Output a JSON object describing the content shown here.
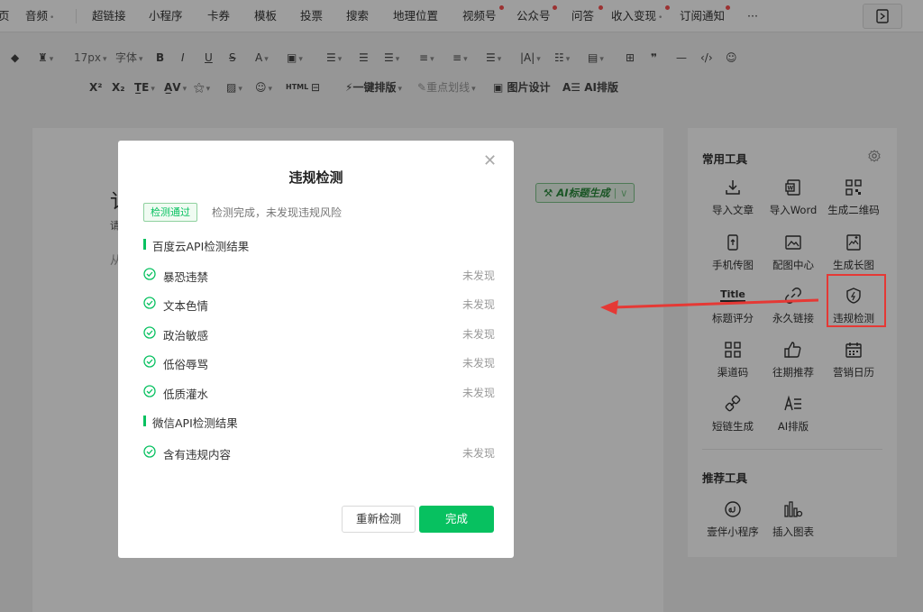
{
  "nav": {
    "items": [
      "页",
      "音频",
      "超链接",
      "小程序",
      "卡券",
      "模板",
      "投票",
      "搜索",
      "地理位置",
      "视频号",
      "公众号",
      "问答",
      "收入变现",
      "订阅通知",
      "···"
    ]
  },
  "toolbar": {
    "font_size": "17px",
    "font_family": "字体",
    "onekey_layout": "一键排版",
    "highlight": "重点划线",
    "image_design": "图片设计",
    "ai_layout": "AI排版"
  },
  "editor": {
    "title_fragment": "讠",
    "sub_fragment": "请",
    "body_fragment": "从",
    "ai_title_button": "AI标题生成"
  },
  "sidebar": {
    "common_tools_title": "常用工具",
    "tools": [
      {
        "label": "导入文章",
        "icon": "import-icon"
      },
      {
        "label": "导入Word",
        "icon": "word-icon"
      },
      {
        "label": "生成二维码",
        "icon": "qrcode-icon"
      },
      {
        "label": "手机传图",
        "icon": "phone-upload-icon"
      },
      {
        "label": "配图中心",
        "icon": "image-icon"
      },
      {
        "label": "生成长图",
        "icon": "long-image-icon"
      },
      {
        "label": "标题评分",
        "icon": "title-score-icon",
        "icon_text": "Title"
      },
      {
        "label": "永久链接",
        "icon": "link-icon"
      },
      {
        "label": "违规检测",
        "icon": "shield-icon"
      },
      {
        "label": "渠道码",
        "icon": "channel-code-icon"
      },
      {
        "label": "往期推荐",
        "icon": "thumbs-up-icon"
      },
      {
        "label": "营销日历",
        "icon": "calendar-icon"
      },
      {
        "label": "短链生成",
        "icon": "short-link-icon"
      },
      {
        "label": "AI排版",
        "icon": "ai-layout-icon"
      }
    ],
    "recommended_tools_title": "推荐工具",
    "recommended": [
      {
        "label": "壹伴小程序",
        "icon": "mini-program-icon"
      },
      {
        "label": "插入图表",
        "icon": "chart-icon"
      }
    ]
  },
  "modal": {
    "title": "违规检测",
    "badge": "检测通过",
    "status": "检测完成，未发现违规风险",
    "section1": "百度云API检测结果",
    "section1_rows": [
      {
        "label": "暴恐违禁",
        "result": "未发现"
      },
      {
        "label": "文本色情",
        "result": "未发现"
      },
      {
        "label": "政治敏感",
        "result": "未发现"
      },
      {
        "label": "低俗辱骂",
        "result": "未发现"
      },
      {
        "label": "低质灌水",
        "result": "未发现"
      }
    ],
    "section2": "微信API检测结果",
    "section2_rows": [
      {
        "label": "含有违规内容",
        "result": "未发现"
      }
    ],
    "recheck_button": "重新检测",
    "done_button": "完成"
  },
  "colors": {
    "accent_green": "#07c160",
    "highlight_red": "#e53935"
  }
}
